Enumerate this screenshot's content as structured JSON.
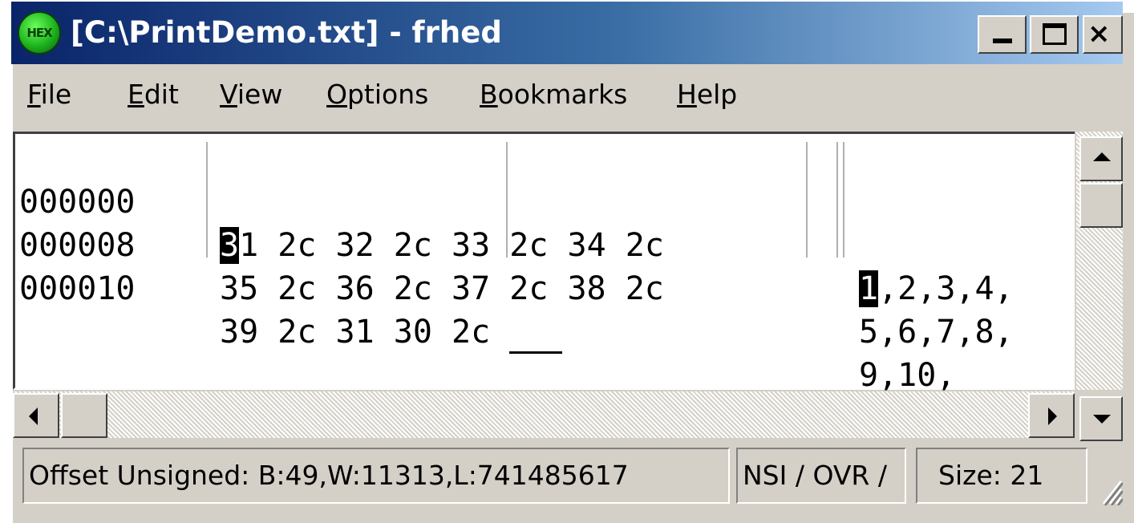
{
  "window": {
    "title": "[C:\\PrintDemo.txt] - frhed",
    "app_icon_text": "HEX",
    "controls": {
      "minimize": "minimize",
      "maximize": "maximize",
      "close": "×"
    }
  },
  "menu": {
    "items": [
      "File",
      "Edit",
      "View",
      "Options",
      "Bookmarks",
      "Help"
    ]
  },
  "editor": {
    "rows": [
      {
        "offset": "000000",
        "hex_first_char": "3",
        "hex_rest": "1 2c 32 2c 33 2c 34 2c",
        "ascii_first": "1",
        "ascii_rest": ",2,3,4,"
      },
      {
        "offset": "000008",
        "hex": "35 2c 36 2c 37 2c 38 2c",
        "ascii": "5,6,7,8,"
      },
      {
        "offset": "000010",
        "hex": "39 2c 31 30 2c",
        "ascii": "9,10,"
      }
    ]
  },
  "statusbar": {
    "offset_info": "Offset Unsigned: B:49,W:11313,L:741485617",
    "mode": "NSI / OVR /",
    "size": "Size: 21"
  },
  "colors": {
    "title_gradient_start": "#0a246a",
    "title_gradient_end": "#a6caf0",
    "face": "#d4d0c8",
    "cursor": "#000000"
  }
}
